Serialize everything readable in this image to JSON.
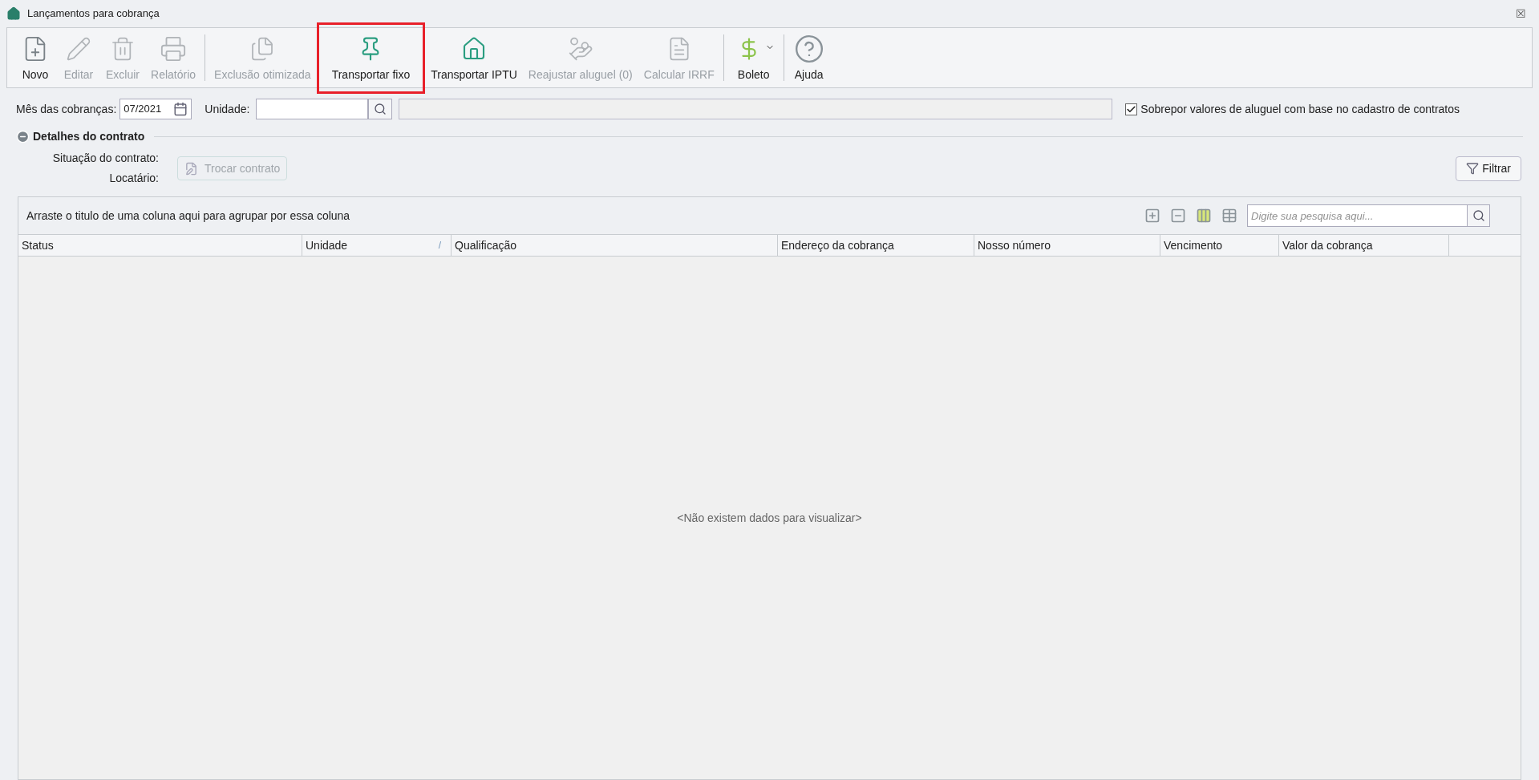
{
  "window": {
    "title": "Lançamentos para cobrança",
    "close_glyph": "☒"
  },
  "toolbar": [
    {
      "kind": "new",
      "label": "Novo",
      "disabled": false,
      "highlighted": false,
      "separator_after": false
    },
    {
      "kind": "edit",
      "label": "Editar",
      "disabled": true,
      "highlighted": false,
      "separator_after": false
    },
    {
      "kind": "delete",
      "label": "Excluir",
      "disabled": true,
      "highlighted": false,
      "separator_after": false
    },
    {
      "kind": "print",
      "label": "Relatório",
      "disabled": true,
      "highlighted": false,
      "separator_after": true
    },
    {
      "kind": "bulk-delete",
      "label": "Exclusão otimizada",
      "disabled": true,
      "highlighted": false,
      "separator_after": false
    },
    {
      "kind": "pin",
      "label": "Transportar fixo",
      "disabled": false,
      "highlighted": true,
      "separator_after": false
    },
    {
      "kind": "house",
      "label": "Transportar IPTU",
      "disabled": false,
      "highlighted": false,
      "separator_after": false
    },
    {
      "kind": "rent",
      "label": "Reajustar aluguel (0)",
      "disabled": true,
      "highlighted": false,
      "separator_after": false
    },
    {
      "kind": "irrf",
      "label": "Calcular IRRF",
      "disabled": true,
      "highlighted": false,
      "separator_after": true
    },
    {
      "kind": "boleto",
      "label": "Boleto",
      "disabled": false,
      "highlighted": false,
      "separator_after": true,
      "dropdown": true
    },
    {
      "kind": "help",
      "label": "Ajuda",
      "disabled": false,
      "highlighted": false,
      "separator_after": false
    }
  ],
  "filters": {
    "month_label": "Mês das cobranças:",
    "month_value": "07/2021",
    "unit_label": "Unidade:",
    "override": {
      "label": "Sobrepor valores de aluguel com base no cadastro de contratos",
      "checked": true
    }
  },
  "contract_details": {
    "title": "Detalhes do contrato",
    "expanded": true,
    "situation_label": "Situação do contrato:",
    "tenant_label": "Locatário:",
    "change_button": {
      "label": "Trocar contrato",
      "disabled": true
    },
    "filter_button": "Filtrar"
  },
  "grid": {
    "group_hint": "Arraste o titulo de uma coluna aqui para agrupar por essa coluna",
    "search_placeholder": "Digite sua pesquisa aqui...",
    "columns": [
      {
        "label": "Status",
        "sorted": false
      },
      {
        "label": "Unidade",
        "sorted": true
      },
      {
        "label": "Qualificação",
        "sorted": false
      },
      {
        "label": "Endereço da cobrança",
        "sorted": false
      },
      {
        "label": "Nosso número",
        "sorted": false
      },
      {
        "label": "Vencimento",
        "sorted": false
      },
      {
        "label": "Valor da cobrança",
        "sorted": false
      }
    ],
    "sort_glyph": "/",
    "empty_message": "<Não existem dados para visualizar>"
  }
}
